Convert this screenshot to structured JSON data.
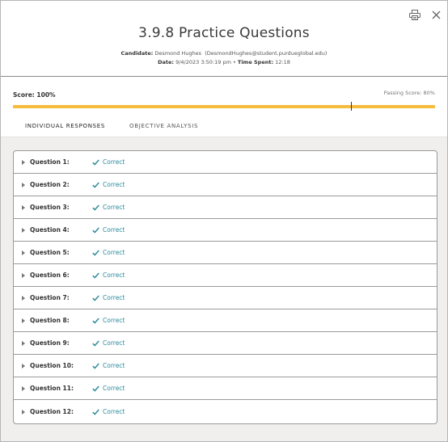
{
  "header": {
    "title": "3.9.8 Practice Questions",
    "candidate_label": "Candidate:",
    "candidate_value": "Desmond Hughes  (DesmondHughes@student.purdueglobal.edu)",
    "date_label": "Date:",
    "date_value": "9/4/2023 3:50:19 pm",
    "separator": " • ",
    "time_label": "Time Spent:",
    "time_value": "12:18"
  },
  "score": {
    "label": "Score: 100%",
    "passing_label": "Passing Score: 80%",
    "score_percent": 100,
    "passing_percent": 80
  },
  "tabs": [
    {
      "label": "INDIVIDUAL RESPONSES",
      "active": true
    },
    {
      "label": "OBJECTIVE ANALYSIS",
      "active": false
    }
  ],
  "questions": [
    {
      "label": "Question 1:",
      "status": "Correct"
    },
    {
      "label": "Question 2:",
      "status": "Correct"
    },
    {
      "label": "Question 3:",
      "status": "Correct"
    },
    {
      "label": "Question 4:",
      "status": "Correct"
    },
    {
      "label": "Question 5:",
      "status": "Correct"
    },
    {
      "label": "Question 6:",
      "status": "Correct"
    },
    {
      "label": "Question 7:",
      "status": "Correct"
    },
    {
      "label": "Question 8:",
      "status": "Correct"
    },
    {
      "label": "Question 9:",
      "status": "Correct"
    },
    {
      "label": "Question 10:",
      "status": "Correct"
    },
    {
      "label": "Question 11:",
      "status": "Correct"
    },
    {
      "label": "Question 12:",
      "status": "Correct"
    }
  ],
  "colors": {
    "accent": "#2f86b0",
    "score_bar": "#f6bc3b",
    "correct": "#2a8a9c",
    "background": "#f0efed"
  },
  "icons": {
    "print": "print-icon",
    "close": "close-icon",
    "expand": "caret-right-icon",
    "status": "check-icon"
  }
}
